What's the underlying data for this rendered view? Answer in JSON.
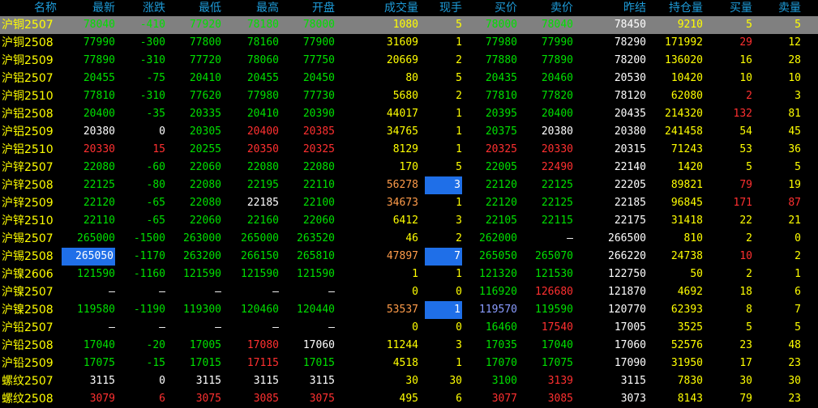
{
  "header": [
    "名称",
    "最新",
    "涨跌",
    "最低",
    "最高",
    "开盘",
    "成交量",
    "现手",
    "买价",
    "卖价",
    "昨结",
    "持仓量",
    "买量",
    "卖量"
  ],
  "colors": {
    "g": "#00e000",
    "r": "#ff3030",
    "w": "#ffffff",
    "y": "#ffff00",
    "o": "#ff9c4a",
    "b": "#8a9cff",
    "d": "#cccccc",
    "header": "#1e9bd8",
    "highlight": "#1f6fe8"
  },
  "rows": [
    {
      "v": [
        "沪铜2507",
        "78040",
        "-410",
        "77920",
        "78180",
        "78000",
        "1080",
        "5",
        "78000",
        "78040",
        "78450",
        "9210",
        "5",
        "5"
      ],
      "c": [
        "y",
        "g",
        "g",
        "g",
        "g",
        "g",
        "y",
        "y",
        "g",
        "g",
        "w",
        "y",
        "y",
        "y"
      ],
      "selected": true
    },
    {
      "v": [
        "沪铜2508",
        "77990",
        "-300",
        "77800",
        "78160",
        "77900",
        "31609",
        "1",
        "77980",
        "77990",
        "78290",
        "171992",
        "29",
        "12"
      ],
      "c": [
        "y",
        "g",
        "g",
        "g",
        "g",
        "g",
        "y",
        "y",
        "g",
        "g",
        "w",
        "y",
        "r",
        "y"
      ]
    },
    {
      "v": [
        "沪铜2509",
        "77890",
        "-310",
        "77720",
        "78060",
        "77750",
        "20669",
        "2",
        "77880",
        "77890",
        "78200",
        "136020",
        "16",
        "28"
      ],
      "c": [
        "y",
        "g",
        "g",
        "g",
        "g",
        "g",
        "y",
        "y",
        "g",
        "g",
        "w",
        "y",
        "y",
        "y"
      ]
    },
    {
      "v": [
        "沪铝2507",
        "20455",
        "-75",
        "20410",
        "20455",
        "20450",
        "80",
        "5",
        "20435",
        "20460",
        "20530",
        "10420",
        "10",
        "10"
      ],
      "c": [
        "y",
        "g",
        "g",
        "g",
        "g",
        "g",
        "y",
        "y",
        "g",
        "g",
        "w",
        "y",
        "y",
        "y"
      ]
    },
    {
      "v": [
        "沪铜2510",
        "77810",
        "-310",
        "77620",
        "77980",
        "77730",
        "5680",
        "2",
        "77810",
        "77820",
        "78120",
        "62080",
        "2",
        "3"
      ],
      "c": [
        "y",
        "g",
        "g",
        "g",
        "g",
        "g",
        "y",
        "y",
        "g",
        "g",
        "w",
        "y",
        "r",
        "y"
      ]
    },
    {
      "v": [
        "沪铝2508",
        "20400",
        "-35",
        "20335",
        "20410",
        "20390",
        "44017",
        "1",
        "20395",
        "20400",
        "20435",
        "214320",
        "132",
        "81"
      ],
      "c": [
        "y",
        "g",
        "g",
        "g",
        "g",
        "g",
        "y",
        "y",
        "g",
        "g",
        "w",
        "y",
        "r",
        "y"
      ]
    },
    {
      "v": [
        "沪铝2509",
        "20380",
        "0",
        "20305",
        "20400",
        "20385",
        "34765",
        "1",
        "20375",
        "20380",
        "20380",
        "241458",
        "54",
        "45"
      ],
      "c": [
        "y",
        "w",
        "w",
        "g",
        "r",
        "r",
        "y",
        "y",
        "g",
        "w",
        "w",
        "y",
        "y",
        "y"
      ]
    },
    {
      "v": [
        "沪铝2510",
        "20330",
        "15",
        "20255",
        "20350",
        "20325",
        "8129",
        "1",
        "20325",
        "20330",
        "20315",
        "71243",
        "53",
        "36"
      ],
      "c": [
        "y",
        "r",
        "r",
        "g",
        "r",
        "r",
        "y",
        "y",
        "r",
        "r",
        "w",
        "y",
        "y",
        "y"
      ]
    },
    {
      "v": [
        "沪锌2507",
        "22080",
        "-60",
        "22060",
        "22080",
        "22080",
        "170",
        "5",
        "22005",
        "22490",
        "22140",
        "1420",
        "5",
        "5"
      ],
      "c": [
        "y",
        "g",
        "g",
        "g",
        "g",
        "g",
        "y",
        "y",
        "g",
        "r",
        "w",
        "y",
        "y",
        "y"
      ]
    },
    {
      "v": [
        "沪锌2508",
        "22125",
        "-80",
        "22080",
        "22195",
        "22110",
        "56278",
        "3",
        "22120",
        "22125",
        "22205",
        "89821",
        "79",
        "19"
      ],
      "c": [
        "y",
        "g",
        "g",
        "g",
        "g",
        "g",
        "o",
        "w",
        "g",
        "g",
        "w",
        "y",
        "r",
        "y"
      ],
      "hl": [
        7
      ]
    },
    {
      "v": [
        "沪锌2509",
        "22120",
        "-65",
        "22080",
        "22185",
        "22100",
        "34673",
        "1",
        "22120",
        "22125",
        "22185",
        "96845",
        "171",
        "87"
      ],
      "c": [
        "y",
        "g",
        "g",
        "g",
        "w",
        "g",
        "o",
        "y",
        "g",
        "g",
        "w",
        "y",
        "r",
        "r"
      ]
    },
    {
      "v": [
        "沪锌2510",
        "22110",
        "-65",
        "22060",
        "22160",
        "22060",
        "6412",
        "3",
        "22105",
        "22115",
        "22175",
        "31418",
        "22",
        "21"
      ],
      "c": [
        "y",
        "g",
        "g",
        "g",
        "g",
        "g",
        "y",
        "y",
        "g",
        "g",
        "w",
        "y",
        "y",
        "y"
      ]
    },
    {
      "v": [
        "沪锡2507",
        "265000",
        "-1500",
        "263000",
        "265000",
        "263520",
        "46",
        "2",
        "262000",
        "—",
        "266500",
        "810",
        "2",
        "0"
      ],
      "c": [
        "y",
        "g",
        "g",
        "g",
        "g",
        "g",
        "y",
        "y",
        "g",
        "w",
        "w",
        "y",
        "y",
        "y"
      ]
    },
    {
      "v": [
        "沪锡2508",
        "265050",
        "-1170",
        "263200",
        "266150",
        "265810",
        "47897",
        "7",
        "265050",
        "265070",
        "266220",
        "24738",
        "10",
        "2"
      ],
      "c": [
        "y",
        "w",
        "g",
        "g",
        "g",
        "g",
        "o",
        "w",
        "g",
        "g",
        "w",
        "y",
        "r",
        "y"
      ],
      "hl": [
        1,
        7
      ]
    },
    {
      "v": [
        "沪镍2606",
        "121590",
        "-1160",
        "121590",
        "121590",
        "121590",
        "1",
        "1",
        "121320",
        "121530",
        "122750",
        "50",
        "2",
        "1"
      ],
      "c": [
        "y",
        "g",
        "g",
        "g",
        "g",
        "g",
        "y",
        "y",
        "g",
        "g",
        "w",
        "y",
        "y",
        "y"
      ]
    },
    {
      "v": [
        "沪镍2507",
        "—",
        "—",
        "—",
        "—",
        "—",
        "0",
        "0",
        "116920",
        "126680",
        "121870",
        "4692",
        "18",
        "6"
      ],
      "c": [
        "y",
        "w",
        "w",
        "w",
        "w",
        "w",
        "y",
        "y",
        "g",
        "r",
        "w",
        "y",
        "y",
        "y"
      ]
    },
    {
      "v": [
        "沪镍2508",
        "119580",
        "-1190",
        "119300",
        "120460",
        "120440",
        "53537",
        "1",
        "119570",
        "119590",
        "120770",
        "62393",
        "8",
        "7"
      ],
      "c": [
        "y",
        "g",
        "g",
        "g",
        "g",
        "g",
        "o",
        "w",
        "b",
        "g",
        "w",
        "y",
        "y",
        "y"
      ],
      "hl": [
        7
      ]
    },
    {
      "v": [
        "沪铅2507",
        "—",
        "—",
        "—",
        "—",
        "—",
        "0",
        "0",
        "16460",
        "17540",
        "17005",
        "3525",
        "5",
        "5"
      ],
      "c": [
        "y",
        "w",
        "w",
        "w",
        "w",
        "w",
        "y",
        "y",
        "g",
        "r",
        "w",
        "y",
        "y",
        "y"
      ]
    },
    {
      "v": [
        "沪铅2508",
        "17040",
        "-20",
        "17005",
        "17080",
        "17060",
        "11244",
        "3",
        "17035",
        "17040",
        "17060",
        "52576",
        "23",
        "48"
      ],
      "c": [
        "y",
        "g",
        "g",
        "g",
        "r",
        "w",
        "y",
        "y",
        "g",
        "g",
        "w",
        "y",
        "y",
        "y"
      ]
    },
    {
      "v": [
        "沪铅2509",
        "17075",
        "-15",
        "17015",
        "17115",
        "17015",
        "4518",
        "1",
        "17070",
        "17075",
        "17090",
        "31950",
        "17",
        "23"
      ],
      "c": [
        "y",
        "g",
        "g",
        "g",
        "r",
        "g",
        "y",
        "y",
        "g",
        "g",
        "w",
        "y",
        "y",
        "y"
      ]
    },
    {
      "v": [
        "螺纹2507",
        "3115",
        "0",
        "3115",
        "3115",
        "3115",
        "30",
        "30",
        "3100",
        "3139",
        "3115",
        "7830",
        "30",
        "30"
      ],
      "c": [
        "y",
        "w",
        "w",
        "w",
        "w",
        "w",
        "y",
        "y",
        "g",
        "r",
        "w",
        "y",
        "y",
        "y"
      ]
    },
    {
      "v": [
        "螺纹2508",
        "3079",
        "6",
        "3075",
        "3085",
        "3075",
        "495",
        "6",
        "3077",
        "3085",
        "3073",
        "8143",
        "79",
        "23"
      ],
      "c": [
        "y",
        "r",
        "r",
        "r",
        "r",
        "r",
        "y",
        "y",
        "r",
        "r",
        "w",
        "y",
        "y",
        "y"
      ]
    }
  ]
}
